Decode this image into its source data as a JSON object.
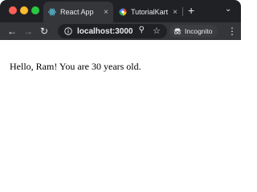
{
  "browser": {
    "tabs": [
      {
        "title": "React App",
        "favicon": "react-icon",
        "active": true,
        "close_glyph": "×"
      },
      {
        "title": "TutorialKart",
        "favicon": "tutorialkart-icon",
        "active": false,
        "close_glyph": "×"
      }
    ],
    "new_tab_glyph": "+",
    "tab_search_glyph": "⌄",
    "nav": {
      "back_glyph": "←",
      "forward_glyph": "→",
      "reload_glyph": "↻"
    },
    "address_bar": {
      "url": "localhost:3000",
      "zoom_glyph": "⚲",
      "bookmark_glyph": "☆"
    },
    "incognito_label": "Incognito",
    "menu_glyph": "⋮",
    "colors": {
      "tabstrip": "#202124",
      "toolbar": "#35363a",
      "close_light": "#ff5f57",
      "minimize_light": "#febc2e",
      "maximize_light": "#28c840"
    }
  },
  "page": {
    "message": "Hello, Ram! You are 30 years old."
  }
}
